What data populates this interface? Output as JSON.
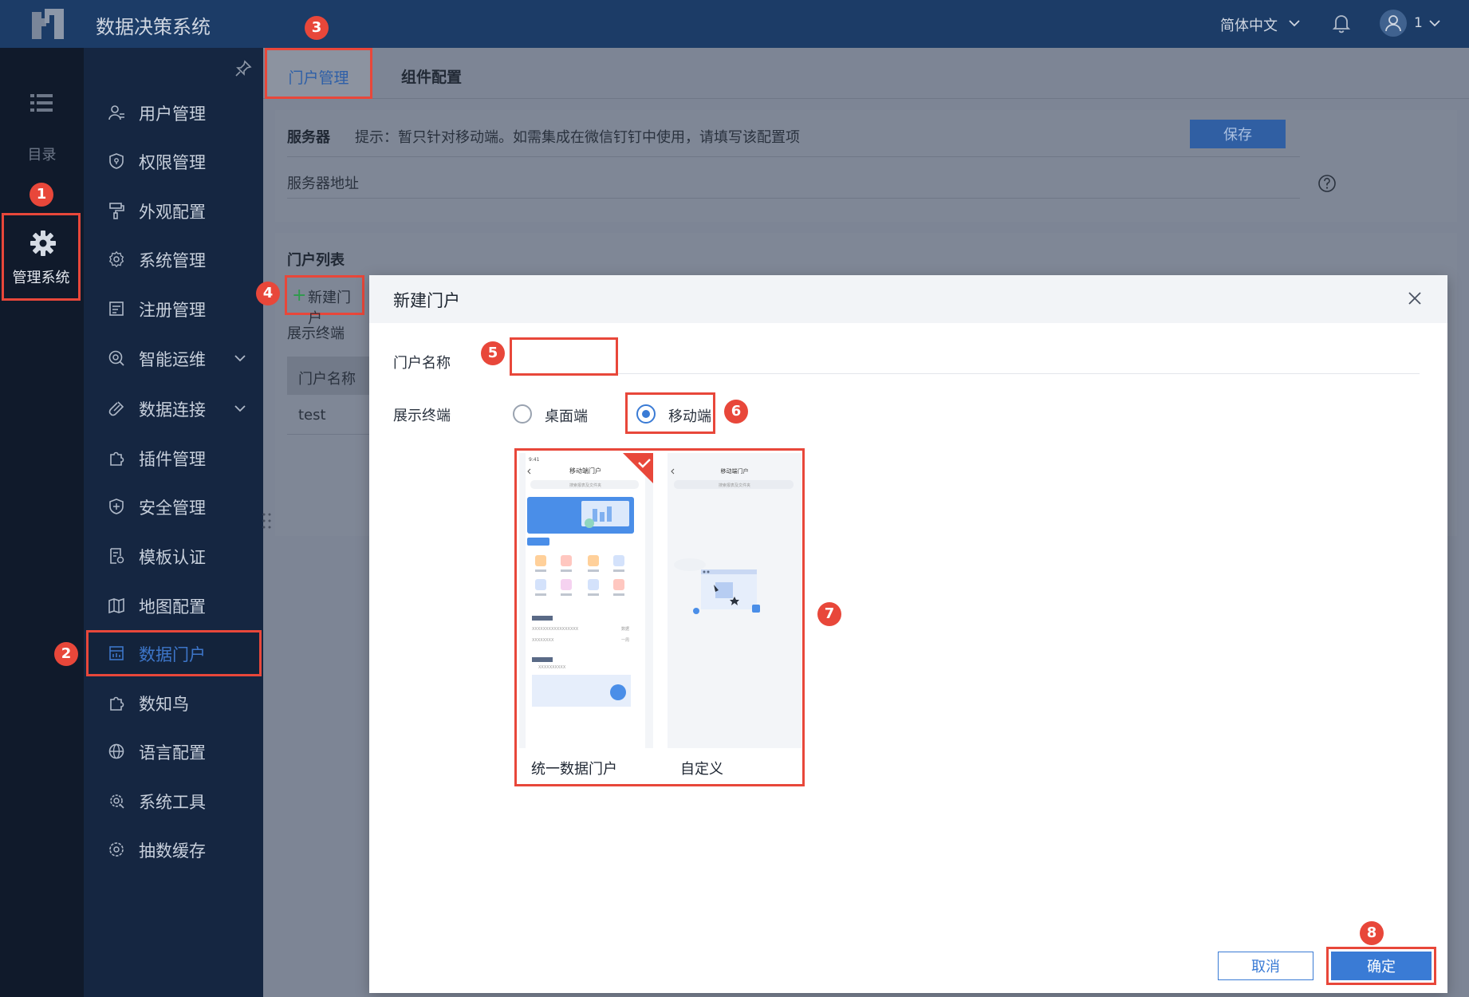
{
  "app": {
    "title": "数据决策系统"
  },
  "header": {
    "language": "简体中文",
    "user_name": "1"
  },
  "rail": {
    "directory_label": "目录",
    "manage_label": "管理系统"
  },
  "sidebar": {
    "items": [
      {
        "label": "用户管理",
        "icon": "user-icon"
      },
      {
        "label": "权限管理",
        "icon": "shield-icon"
      },
      {
        "label": "外观配置",
        "icon": "paint-roller-icon"
      },
      {
        "label": "系统管理",
        "icon": "gear-icon"
      },
      {
        "label": "注册管理",
        "icon": "register-icon"
      },
      {
        "label": "智能运维",
        "icon": "ops-icon",
        "expandable": true
      },
      {
        "label": "数据连接",
        "icon": "link-icon",
        "expandable": true
      },
      {
        "label": "插件管理",
        "icon": "puzzle-icon"
      },
      {
        "label": "安全管理",
        "icon": "security-shield-icon"
      },
      {
        "label": "模板认证",
        "icon": "template-cert-icon"
      },
      {
        "label": "地图配置",
        "icon": "map-icon"
      },
      {
        "label": "数据门户",
        "icon": "portal-icon",
        "active": true
      },
      {
        "label": "数知鸟",
        "icon": "bird-icon"
      },
      {
        "label": "语言配置",
        "icon": "globe-icon"
      },
      {
        "label": "系统工具",
        "icon": "tool-gear-icon"
      },
      {
        "label": "抽数缓存",
        "icon": "cache-gear-icon"
      }
    ]
  },
  "main": {
    "tabs": [
      {
        "label": "门户管理",
        "active": true
      },
      {
        "label": "组件配置",
        "active": false
      }
    ],
    "server": {
      "label": "服务器",
      "hint": "提示：暂只针对移动端。如需集成在微信钉钉中使用，请填写该配置项",
      "save_label": "保存",
      "address_label": "服务器地址"
    },
    "portal_list": {
      "title": "门户列表",
      "new_button": "新建门户",
      "display_terminal_label": "展示终端",
      "column_name": "门户名称",
      "rows": [
        "test"
      ]
    }
  },
  "modal": {
    "title": "新建门户",
    "name_label": "门户名称",
    "name_value": "",
    "terminal_label": "展示终端",
    "terminal_options": [
      {
        "label": "桌面端",
        "selected": false
      },
      {
        "label": "移动端",
        "selected": true
      }
    ],
    "templates": [
      {
        "label": "统一数据门户",
        "selected": true,
        "preview_title": "移动端门户",
        "preview_time": "9:41",
        "preview_search": "搜索报表及文件夹",
        "preview_line_left": "XXXXXXXXXXXXXXXXX",
        "preview_line_right": "数据",
        "preview_line2_left": "XXXXXXXX",
        "preview_line2_right": "一周",
        "preview_mini": "XXXXXXXXXX"
      },
      {
        "label": "自定义",
        "selected": false,
        "preview_title": "移动端门户",
        "preview_search": "搜索报表及文件夹"
      }
    ],
    "cancel_label": "取消",
    "ok_label": "确定"
  },
  "callouts": [
    "1",
    "2",
    "3",
    "4",
    "5",
    "6",
    "7",
    "8"
  ],
  "colors": {
    "topbar": "#1c3c67",
    "rail": "#101a2b",
    "sidebar": "#152641",
    "accent": "#3a7bd5",
    "callout": "#e8473a",
    "overlay": "#7d8595"
  }
}
